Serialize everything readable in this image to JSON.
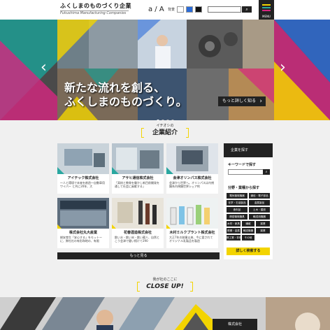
{
  "header": {
    "logo_ja": "ふくしまのものづくり企業",
    "logo_en": "Fukushima Manufacturing Companies",
    "font_size_toggle": "a / A",
    "bg_label": "背景",
    "bg_swatches": [
      "#ffffff",
      "#2b6cd8",
      "#111111"
    ],
    "menu_label": "MENU",
    "menu_colors": [
      "#f3d400",
      "#2aa7a0",
      "#d6267f"
    ]
  },
  "hero": {
    "title_line1": "新たな流れを創る、",
    "title_line2": "ふくしまのものづくり。",
    "more_label": "もっと詳しく知る",
    "prev_arrow": "‹",
    "next_arrow": "›",
    "slide_count": 4,
    "active_slide": 1
  },
  "companies_section": {
    "pre_label": "イチオシの",
    "title": "企業紹介",
    "more_label": "もっと見る",
    "cards": [
      {
        "name": "アイテック株式会社",
        "desc": "〜人と環境で未来を創造〜自動車用ワイパー と共に20年、大"
      },
      {
        "name": "アサヒ通信株式会社",
        "desc": "「高校と教育を働かし新目前開発を通して社会に貢献する」"
      },
      {
        "name": "会津オリンパス株式会社",
        "desc": "会津から世界へ。オリンパスは内視鏡系内視鏡世界シェア約"
      },
      {
        "name": "株式会社丸大産業",
        "desc": "総安育生「安心する」をモットーに、弊社社の有形和地の、有限"
      },
      {
        "name": "花春酒造株式会社",
        "desc": "飲い水・飲い米・飲い蔵人、自然とこう会津で健い続けて290"
      },
      {
        "name": "木村ミルクプラント株式会社",
        "desc": "大正7年の創業以来、今に愛されてオリジナル乳製品を製造"
      }
    ]
  },
  "sidebar": {
    "head_label": "企業を探す",
    "keyword_label": "キーワードで探す",
    "category_label": "分野・業種から探す",
    "tags": [
      "電気機械機器",
      "通信・電子部品",
      "化学・石油製品",
      "金属製品",
      "食料品",
      "土木・建設",
      "精密機械器具",
      "輸送用機器",
      "木材・家具",
      "繊維",
      "窯業",
      "鉄鋼・金属",
      "輸送機器",
      "窯業",
      "鉄工業・非鉄",
      "その他"
    ],
    "search_button": "詳しく検索する"
  },
  "closeup": {
    "pre_label": "我が社のここに",
    "title": "CLOSE UP!",
    "company_label": "株式会社"
  }
}
